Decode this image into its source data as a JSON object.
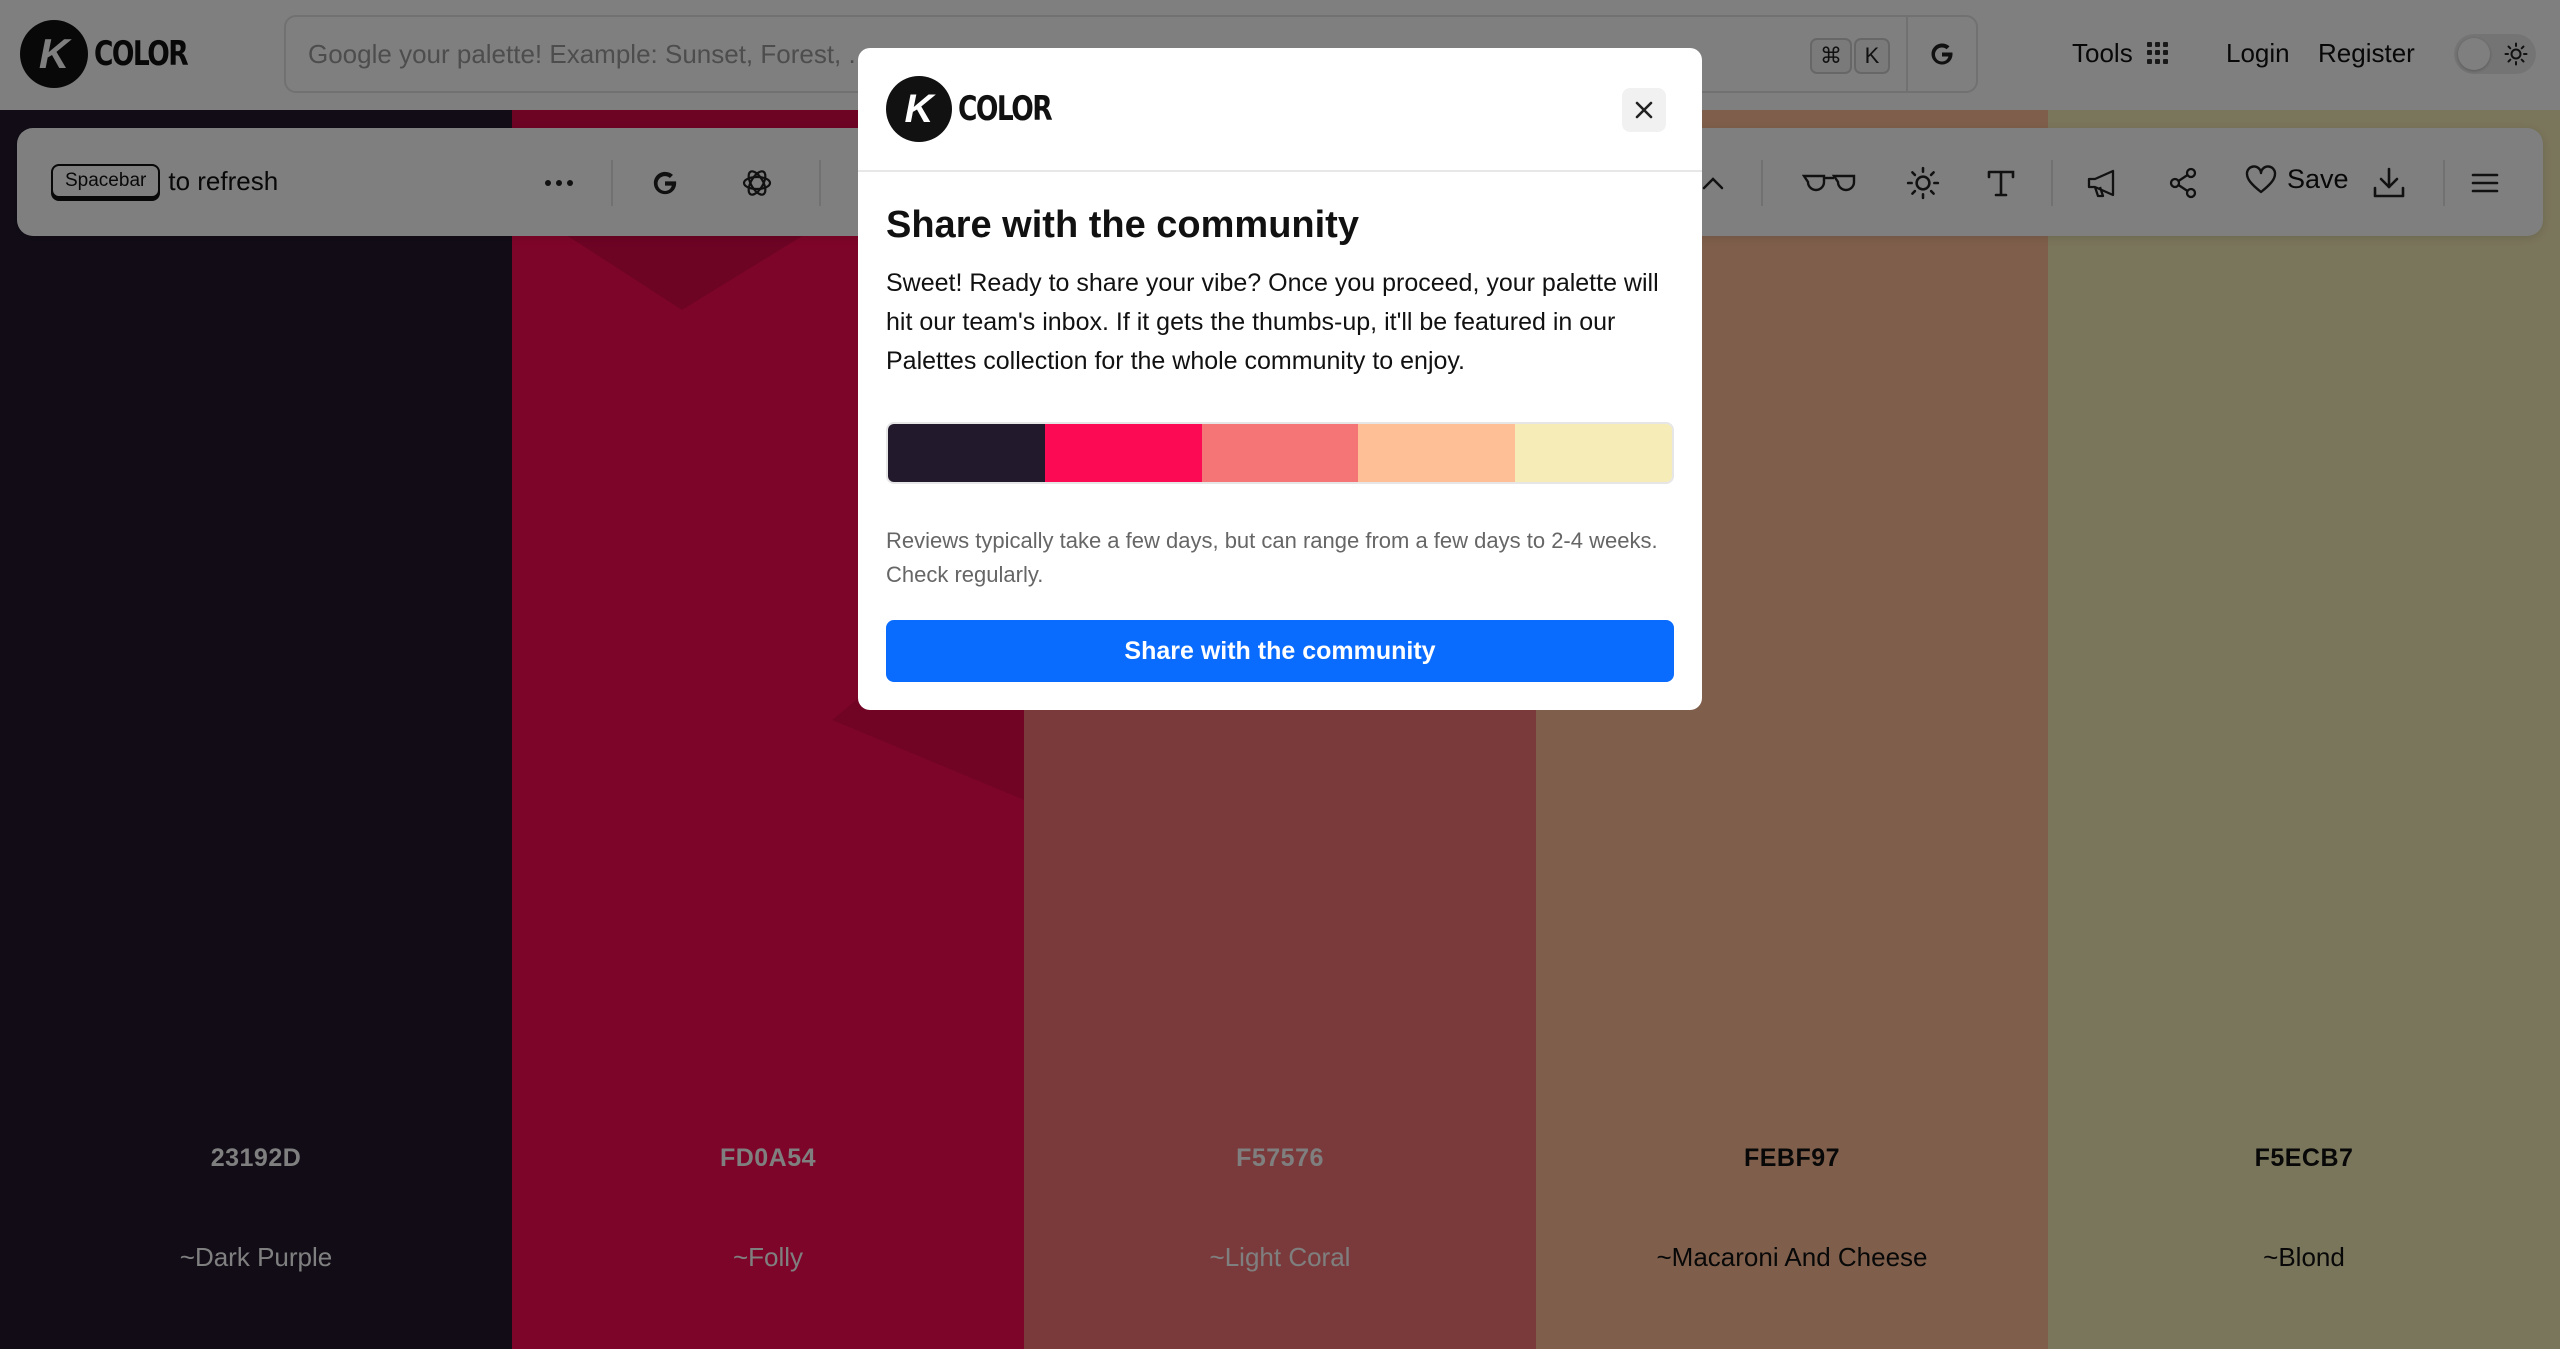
{
  "header": {
    "logo_letter": "K",
    "logo_text": "COLOR",
    "search_placeholder": "Google your palette! Example: Sunset, Forest, ...",
    "shortcut_keys": [
      "⌘",
      "K"
    ],
    "tools_label": "Tools",
    "login_label": "Login",
    "register_label": "Register"
  },
  "toolbar": {
    "hint_key": "Spacebar",
    "hint_text": "to refresh",
    "save_label": "Save",
    "icons": [
      "more-icon",
      "google-icon",
      "openai-icon",
      "chevron-up-icon",
      "glasses-icon",
      "brightness-icon",
      "text-icon",
      "megaphone-icon",
      "share-icon",
      "heart-icon",
      "download-icon",
      "menu-icon"
    ]
  },
  "palette": [
    {
      "hex": "23192D",
      "name": "~Dark Purple",
      "color": "#23192D",
      "text_color": "#ffffff"
    },
    {
      "hex": "FD0A54",
      "name": "~Folly",
      "color": "#FD0A54",
      "text_color": "#ffffff"
    },
    {
      "hex": "F57576",
      "name": "~Light Coral",
      "color": "#F57576",
      "text_color": "#ffffff"
    },
    {
      "hex": "FEBF97",
      "name": "~Macaroni And Cheese",
      "color": "#FEBF97",
      "text_color": "#111111"
    },
    {
      "hex": "F5ECB7",
      "name": "~Blond",
      "color": "#F5ECB7",
      "text_color": "#111111"
    }
  ],
  "modal": {
    "logo_letter": "K",
    "logo_text": "COLOR",
    "title": "Share with the community",
    "body": "Sweet! Ready to share your vibe? Once you proceed, your palette will hit our team's inbox. If it gets the thumbs-up, it'll be featured in our Palettes collection for the whole community to enjoy.",
    "note": "Reviews typically take a few days, but can range from a few days to 2-4 weeks. Check regularly.",
    "cta_label": "Share with the community"
  },
  "colors": {
    "accent": "#0a6cff",
    "overlay": "rgba(0,0,0,0.5)"
  }
}
